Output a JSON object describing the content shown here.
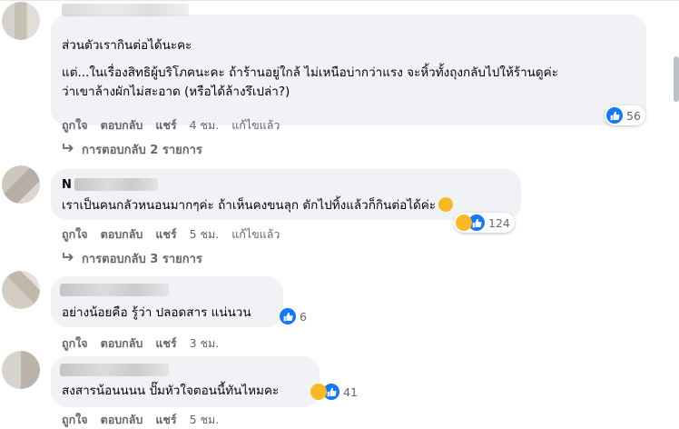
{
  "comments": [
    {
      "author_visible": "",
      "lines": [
        "ส่วนตัวเรากินต่อได้นะคะ",
        "แต่...ในเรื่องสิทธิผู้บริโภคนะคะ ถ้าร้านอยู่ใกล้ ไม่เหนือบ่ากว่าแรง จะหิ้วทั้งถุงกลับไปให้ร้านดูค่ะ",
        "ว่าเขาล้างผักไม่สะอาด (หรือได้ล้างรึเปล่า?)"
      ],
      "reaction_count": "56",
      "actions": {
        "like": "ถูกใจ",
        "reply": "ตอบกลับ",
        "share": "แชร์",
        "time": "4 ชม.",
        "edited": "แก้ไขแล้ว"
      },
      "replies_label": "การตอบกลับ 2 รายการ"
    },
    {
      "author_visible": "N",
      "lines": [
        "เราเป็นคนกลัวหนอนมากๆค่ะ ถ้าเห็นคงขนลุก ตักไปทิ้งแล้วก็กินต่อได้ค่ะ"
      ],
      "reaction_count": "124",
      "actions": {
        "like": "ถูกใจ",
        "reply": "ตอบกลับ",
        "share": "แชร์",
        "time": "5 ชม.",
        "edited": "แก้ไขแล้ว"
      },
      "replies_label": "การตอบกลับ 3 รายการ"
    },
    {
      "author_visible": "",
      "lines": [
        "อย่างน้อยคือ รู้ว่า ปลอดสาร แน่นวน"
      ],
      "reaction_count": "6",
      "actions": {
        "like": "ถูกใจ",
        "reply": "ตอบกลับ",
        "share": "แชร์",
        "time": "3 ชม."
      }
    },
    {
      "author_visible": "",
      "lines": [
        "สงสารน้อนนนน ปั๊มหัวใจตอนนี้ทันไหมคะ"
      ],
      "reaction_count": "41",
      "actions": {
        "like": "ถูกใจ",
        "reply": "ตอบกลับ",
        "share": "แชร์",
        "time": "5 ชม."
      }
    }
  ],
  "icons": {
    "like": "thumbs-up-icon",
    "haha": "laughing-face-icon",
    "reply_arrow": "reply-arrow-icon"
  },
  "colors": {
    "like_blue": "#1877f2",
    "haha_yellow": "#f7b928",
    "bubble_bg": "#f0f2f5",
    "meta_gray": "#65676b"
  }
}
